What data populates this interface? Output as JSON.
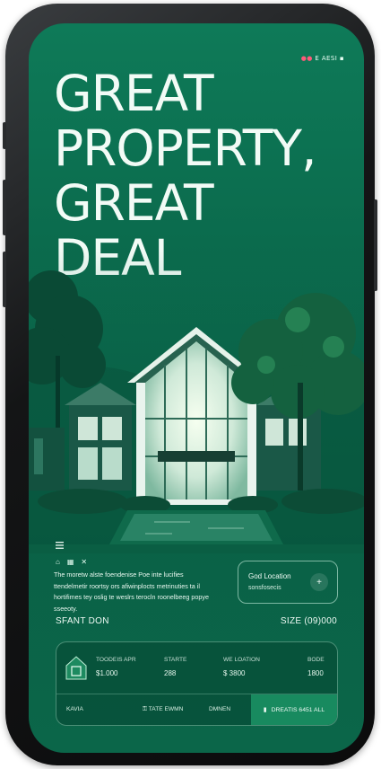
{
  "status_bar": {
    "text": "E AESI"
  },
  "hero": {
    "headline": "GREAT\nPROPERTY,\nGREAT\nDEAL"
  },
  "description": "The moretw alste foendenise Poe inte lucifies ttendelmetir roortsy ors afiwinplocts metrinuties ta il hortifimes tey oslig te weslrs terocln roonelbeeg popye sseeoty.",
  "location_card": {
    "title": "God Location",
    "subtitle": "sonsfosecis",
    "button": "+"
  },
  "summary_row": {
    "left": "SFANT DON",
    "right": "SIZE (09)000"
  },
  "stats": [
    {
      "label": "TOODEIS APR",
      "value": "$1.000"
    },
    {
      "label": "STARTE",
      "value": "288"
    },
    {
      "label": "WE LOATION",
      "value": "$ 3800"
    },
    {
      "label": "BODE",
      "value": "1800"
    }
  ],
  "footer": {
    "left": "KAVIA",
    "middle": "TATE EWMN",
    "right": "DMNEN",
    "cta": "DREATIS 6451 ALL"
  },
  "colors": {
    "background": "#0b6b4d",
    "accent": "#188a5f",
    "text": "#eefaf4"
  },
  "icons": [
    "menu-icon",
    "home-icon",
    "grid-icon",
    "close-icon",
    "plus-icon",
    "key-icon",
    "bookmark-icon"
  ]
}
